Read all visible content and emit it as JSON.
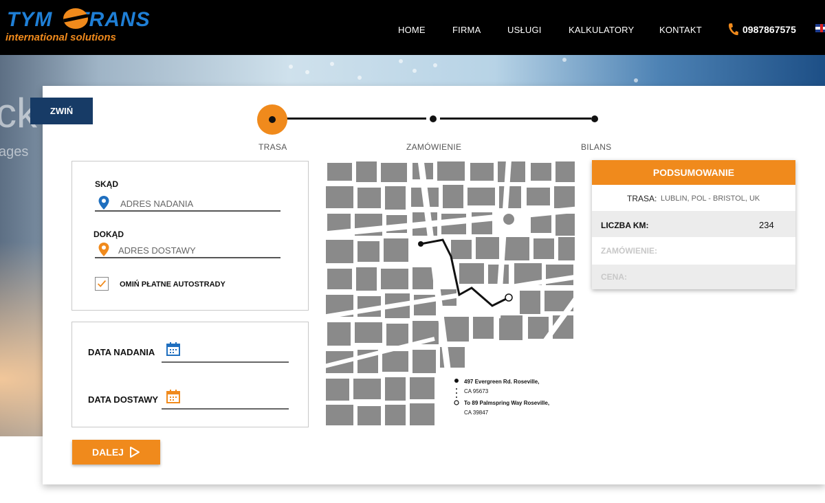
{
  "header": {
    "logo_top": "TYM TRANS",
    "logo_top_left": "TYM",
    "logo_top_right": "TRANS",
    "logo_bottom": "international solutions",
    "nav": [
      "HOME",
      "FIRMA",
      "USŁUGI",
      "KALKULATORY",
      "KONTAKT"
    ],
    "phone": "0987867575",
    "language_flag_icon": "uk-flag-icon"
  },
  "hero": {
    "partial_text_1": "ck",
    "partial_text_2": "ages"
  },
  "card": {
    "collapse_label": "ZWIŃ",
    "steps": [
      "TRASA",
      "ZAMÓWIENIE",
      "BILANS"
    ],
    "active_step": "TRASA",
    "route": {
      "from_label": "SKĄD",
      "from_placeholder": "ADRES NADANIA",
      "to_label": "DOKĄD",
      "to_placeholder": "ADRES DOSTAWY",
      "avoid_tolls_label": "OMIŃ PŁATNE AUTOSTRADY",
      "avoid_tolls_checked": true
    },
    "dates": {
      "send_label": "DATA NADANIA",
      "delivery_label": "DATA DOSTAWY"
    },
    "next_label": "DALEJ",
    "map": {
      "start_line1": "497 Evergreen Rd. Roseville,",
      "start_line2": "CA 95673",
      "end_line1": "To 89 Palmspring Way Roseville,",
      "end_line2": "CA 39847"
    },
    "summary": {
      "title": "PODSUMOWANIE",
      "route_label": "TRASA:",
      "route_value": "LUBLIN, POL - BRISTOL, UK",
      "km_label": "LICZBA KM:",
      "km_value": "234",
      "order_label": "ZAMÓWIENIE:",
      "price_label": "CENA:"
    }
  },
  "colors": {
    "accent_orange": "#f08a1c",
    "navy": "#173b66",
    "blue_pin": "#1f6fbf"
  }
}
